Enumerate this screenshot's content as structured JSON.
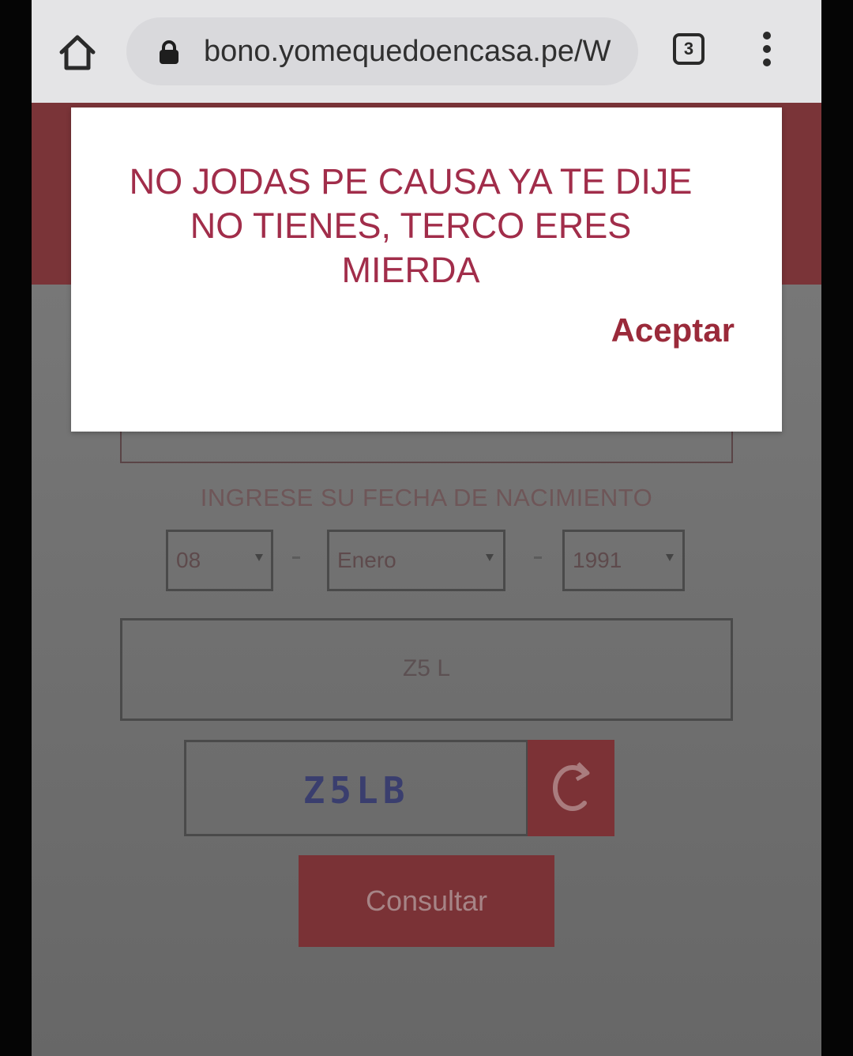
{
  "browser": {
    "url": "bono.yomequedoencasa.pe/W",
    "tab_count": "3"
  },
  "form": {
    "dob_label": "INGRESE SU FECHA DE NACIMIENTO",
    "day_value": "08",
    "month_value": "Enero",
    "year_value": "1991",
    "captcha_input_value": "Z5 L",
    "captcha_code": "Z5LB",
    "submit_label": "Consultar"
  },
  "modal": {
    "message": "NO JODAS PE CAUSA YA TE DIJE NO TIENES, TERCO ERES MIERDA",
    "accept_label": "Aceptar"
  },
  "colors": {
    "brand": "#7a3438",
    "modal_text": "#a12d4a"
  }
}
